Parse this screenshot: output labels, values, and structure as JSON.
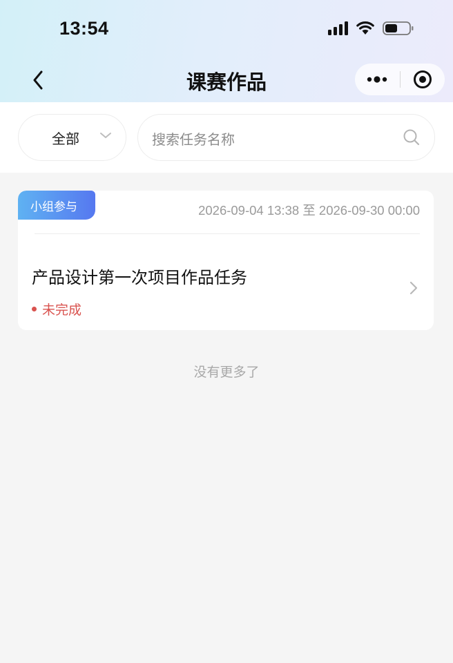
{
  "status_bar": {
    "time": "13:54"
  },
  "nav": {
    "title": "课赛作品",
    "back_icon": "chevron-left-icon",
    "more_icon": "more-dots-icon",
    "close_icon": "target-close-icon"
  },
  "filter": {
    "dropdown_value": "全部",
    "search_placeholder": "搜索任务名称"
  },
  "tasks": [
    {
      "tag": "小组参与",
      "period": "2026-09-04 13:38 至 2026-09-30 00:00",
      "title": "产品设计第一次项目作品任务",
      "status": "未完成"
    }
  ],
  "list_end_text": "没有更多了",
  "colors": {
    "tag_gradient_start": "#5fb2f2",
    "tag_gradient_end": "#5678f0",
    "status_incomplete": "#d9534f",
    "page_background": "#f5f5f5"
  }
}
